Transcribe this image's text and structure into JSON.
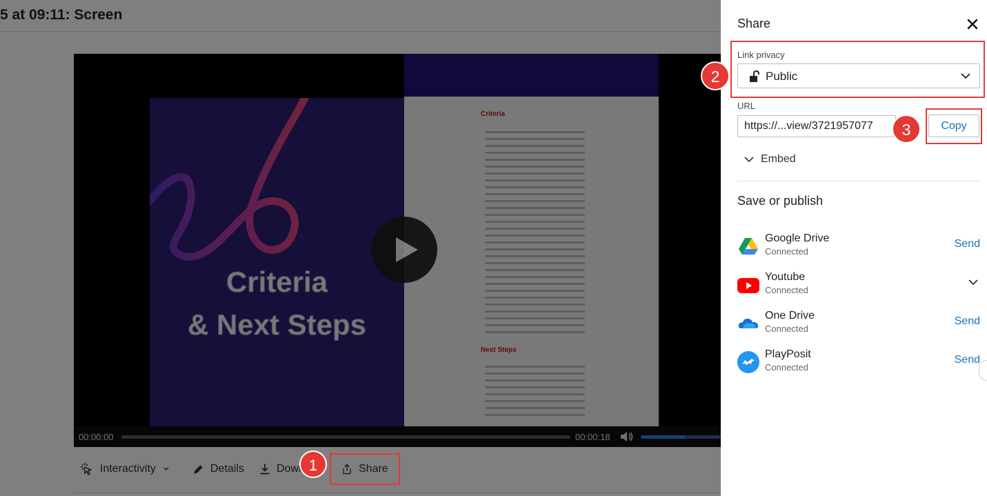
{
  "page": {
    "title": "5 at 09:11: Screen"
  },
  "player": {
    "slide_title_line1": "Criteria",
    "slide_title_line2": "& Next Steps",
    "doc_heading_1": "Criteria",
    "doc_heading_2": "Next Steps",
    "time_current": "00:00:00",
    "time_total": "00:00:18",
    "playback_progress": 0.0,
    "volume_level": 0.55
  },
  "actions": {
    "interactivity_label": "Interactivity",
    "details_label": "Details",
    "download_label": "Download",
    "share_label": "Share"
  },
  "badges": {
    "one": "1",
    "two": "2",
    "three": "3"
  },
  "share_panel": {
    "title": "Share",
    "link_privacy_label": "Link privacy",
    "link_privacy_value": "Public",
    "url_label": "URL",
    "url_value": "https://...view/3721957077",
    "copy_label": "Copy",
    "embed_label": "Embed",
    "publish_heading": "Save or publish",
    "services": [
      {
        "name": "Google Drive",
        "status": "Connected",
        "action": "Send",
        "icon": "google-drive-icon"
      },
      {
        "name": "Youtube",
        "status": "Connected",
        "action": "",
        "icon": "youtube-icon"
      },
      {
        "name": "One Drive",
        "status": "Connected",
        "action": "Send",
        "icon": "onedrive-icon"
      },
      {
        "name": "PlayPosit",
        "status": "Connected",
        "action": "Send",
        "icon": "playposit-icon"
      }
    ]
  },
  "colors": {
    "accent_link": "#1b73b9",
    "annotation_red": "#e53935",
    "slide_purple": "#2a1f72"
  }
}
